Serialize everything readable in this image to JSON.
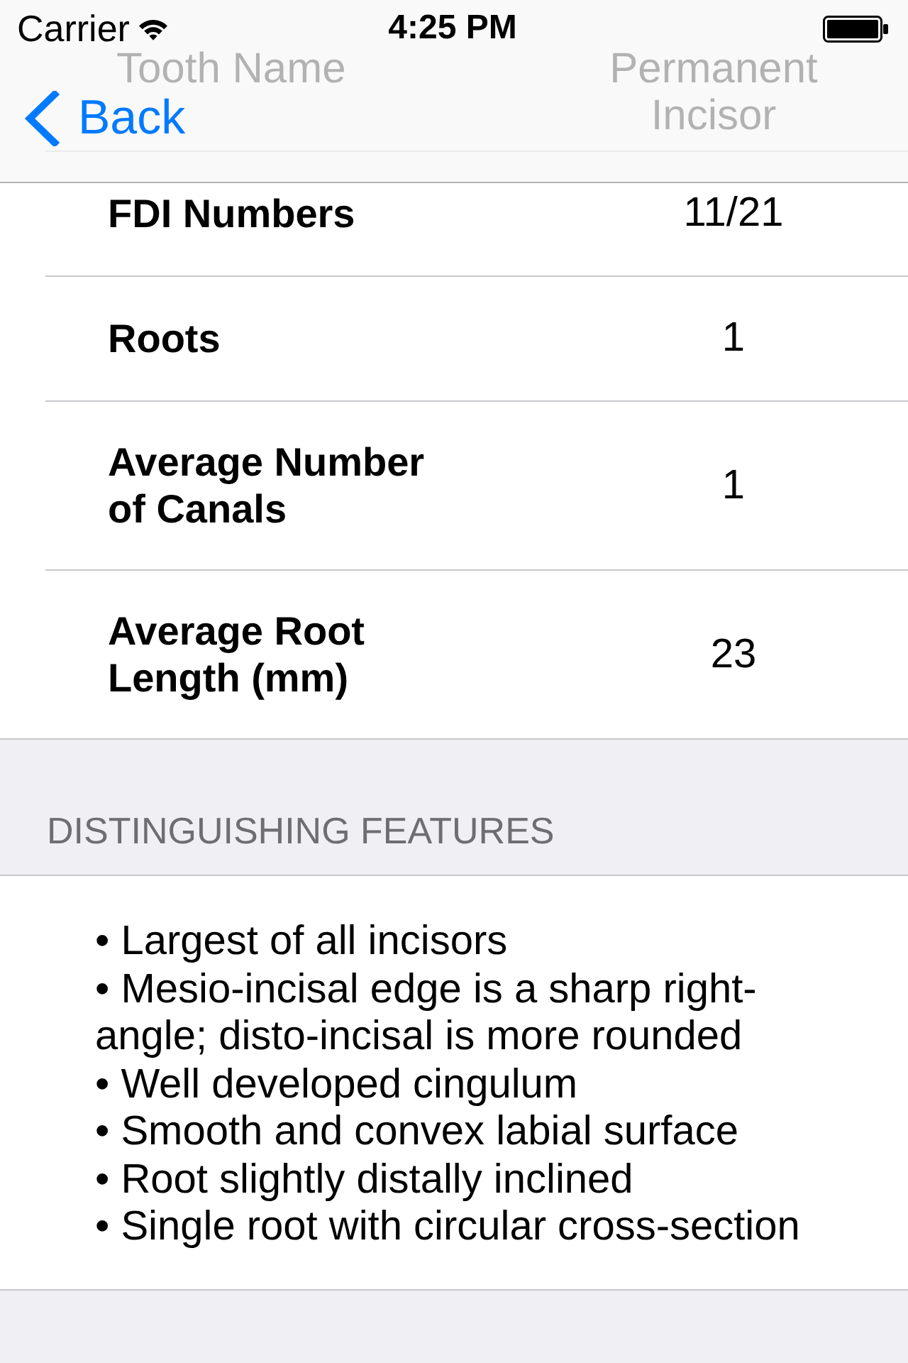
{
  "status_bar": {
    "carrier": "Carrier",
    "time": "4:25 PM"
  },
  "nav_bar": {
    "back_label": "Back"
  },
  "details": [
    {
      "label": "Tooth Name",
      "value": "Permanent Incisor"
    },
    {
      "label": "FDI Numbers",
      "value": "11/21"
    },
    {
      "label": "Roots",
      "value": "1"
    },
    {
      "label": "Average Number of Canals",
      "value": "1"
    },
    {
      "label": "Average Root Length (mm)",
      "value": "23"
    }
  ],
  "features_section": {
    "header": "DISTINGUISHING FEATURES",
    "items": [
      "• Largest of all incisors",
      "• Mesio-incisal edge is a sharp right-angle; disto-incisal is more rounded",
      "• Well developed cingulum",
      "• Smooth and convex labial surface",
      "• Root slightly distally inclined",
      "• Single root with circular cross-section"
    ]
  }
}
